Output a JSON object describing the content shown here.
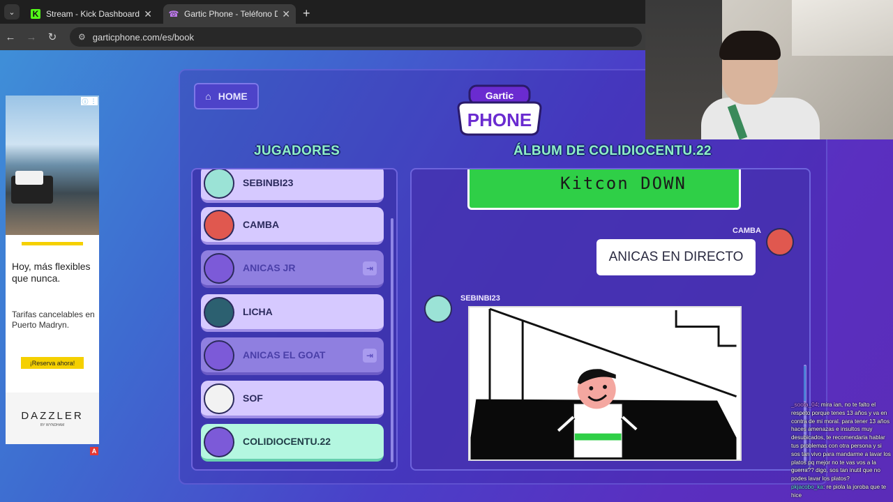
{
  "browser": {
    "tabs": [
      {
        "title": "Stream - Kick Dashboard",
        "favicon": "K",
        "active": false
      },
      {
        "title": "Gartic Phone - Teléfono Descon",
        "favicon": "☎",
        "active": true
      }
    ],
    "url": "garticphone.com/es/book"
  },
  "ad": {
    "headline": "Hoy, más flexibles que nunca.",
    "subtext": "Tarifas cancelables en Puerto Madryn.",
    "cta": "¡Reserva ahora!",
    "brand": "DAZZLER",
    "brand_sub": "BY WYNDHAM",
    "badge": "A"
  },
  "game": {
    "home_label": "HOME",
    "logo_top": "Gartic",
    "logo_bottom": "PHONE",
    "players_title": "JUGADORES",
    "album_title": "ÁLBUM DE COLIDIOCENTU.22",
    "players": [
      {
        "name": "SEBINBI23",
        "state": "normal",
        "avatar_color": "#9be3d6"
      },
      {
        "name": "CAMBA",
        "state": "normal",
        "avatar_color": "#e0584f"
      },
      {
        "name": "ANICAS JR",
        "state": "away",
        "avatar_color": "#7c5ad8"
      },
      {
        "name": "LICHA",
        "state": "normal",
        "avatar_color": "#2c6070"
      },
      {
        "name": "ANICAS EL GOAT",
        "state": "away",
        "avatar_color": "#7c5ad8"
      },
      {
        "name": "SOF",
        "state": "normal",
        "avatar_color": "#f2f2f2"
      },
      {
        "name": "COLIDIOCENTU.22",
        "state": "me",
        "avatar_color": "#7c5ad8"
      }
    ],
    "album": {
      "first_text": "Kitcon DOWN",
      "message_author": "CAMBA",
      "message_text": "ANICAS EN DIRECTO",
      "drawing_author": "SEBINBI23"
    }
  },
  "chat": {
    "messages": [
      {
        "user": "_soota_04",
        "text": ": mira ian, no te falto el respeto porque tenes 13 años y va en contra de mi moral. para tener 13 años haces amenazas e insultos muy desubicados, te recomendaria hablar tus problemas con otra persona y si sos tan vivo para mandarme a lavar los platos pq mejor no te vas vos a la guerra?? digo, sos tan inutil que no podes lavar los platos?"
      },
      {
        "user": "pkjacobo_ka",
        "text": ": re piola la joroba que te hice"
      }
    ]
  }
}
